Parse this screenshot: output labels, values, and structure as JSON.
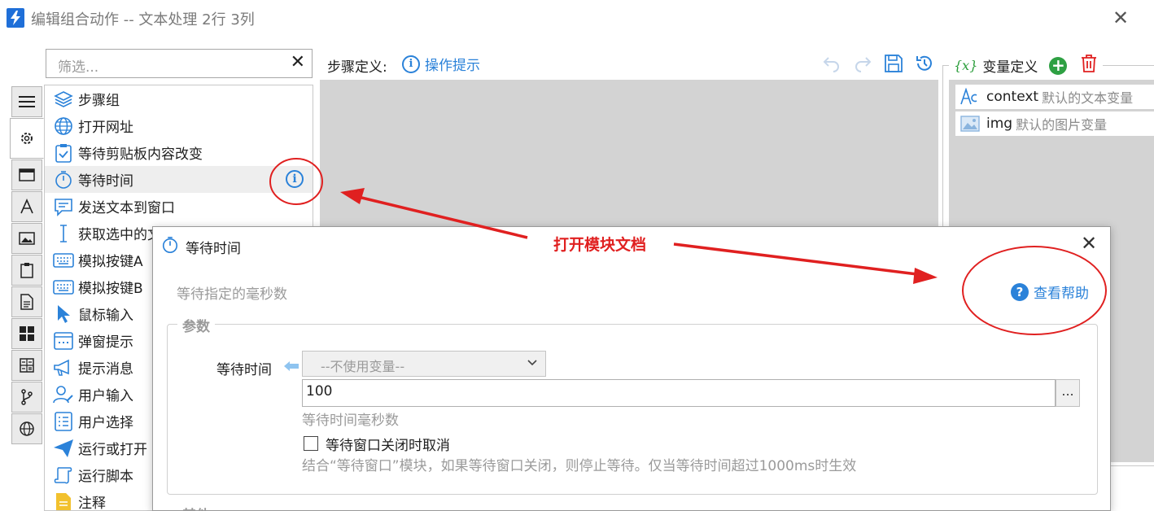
{
  "window": {
    "title": "编辑组合动作 -- 文本处理 2行 3列",
    "close_glyph": "✕"
  },
  "filter": {
    "placeholder": "筛选...",
    "clear_glyph": "✕"
  },
  "vertical_tabs": [
    "menu-icon",
    "gear-icon",
    "window-icon",
    "text-icon",
    "image-icon",
    "clipboard-icon",
    "document-icon",
    "windows-icon",
    "calculator-icon",
    "branch-icon",
    "globe-icon"
  ],
  "modules": [
    {
      "label": "步骤组",
      "icon": "layers-icon"
    },
    {
      "label": "打开网址",
      "icon": "globe-icon"
    },
    {
      "label": "等待剪贴板内容改变",
      "icon": "clipboard-check-icon"
    },
    {
      "label": "等待时间",
      "icon": "stopwatch-icon",
      "selected": true
    },
    {
      "label": "发送文本到窗口",
      "icon": "message-icon"
    },
    {
      "label": "获取选中的文本",
      "icon": "text-cursor-icon"
    },
    {
      "label": "模拟按键A",
      "icon": "keyboard-icon"
    },
    {
      "label": "模拟按键B",
      "icon": "keyboard-icon"
    },
    {
      "label": "鼠标输入",
      "icon": "cursor-icon"
    },
    {
      "label": "弹窗提示",
      "icon": "popup-icon"
    },
    {
      "label": "提示消息",
      "icon": "megaphone-icon"
    },
    {
      "label": "用户输入",
      "icon": "user-edit-icon"
    },
    {
      "label": "用户选择",
      "icon": "list-icon"
    },
    {
      "label": "运行或打开",
      "icon": "send-icon"
    },
    {
      "label": "运行脚本",
      "icon": "script-icon"
    },
    {
      "label": "注释",
      "icon": "note-icon"
    }
  ],
  "steps": {
    "label": "步骤定义:",
    "tip_label": "操作提示"
  },
  "variables": {
    "header": "变量定义",
    "symbol": "{x}",
    "items": [
      {
        "name": "context",
        "desc": "默认的文本变量",
        "icon": "text-var-icon"
      },
      {
        "name": "img",
        "desc": "默认的图片变量",
        "icon": "image-var-icon"
      }
    ]
  },
  "dialog": {
    "title": "等待时间",
    "close_glyph": "✕",
    "description": "等待指定的毫秒数",
    "help_label": "查看帮助",
    "params_legend": "参数",
    "field_label": "等待时间",
    "var_select_value": "--不使用变量--",
    "value": "100",
    "more_label": "...",
    "value_hint": "等待时间毫秒数",
    "checkbox_label": "等待窗口关闭时取消",
    "checkbox_checked": false,
    "checkbox_hint": "结合“等待窗口”模块，如果等待窗口关闭，则停止等待。仅当等待时间超过1000ms时生效",
    "other_legend": "其他"
  },
  "annotation": {
    "text": "打开模块文档",
    "color": "#e02020"
  },
  "colors": {
    "accent": "#2b82d9",
    "canvas": "#d3d3d3",
    "add": "#2ea043",
    "delete": "#e02020"
  }
}
